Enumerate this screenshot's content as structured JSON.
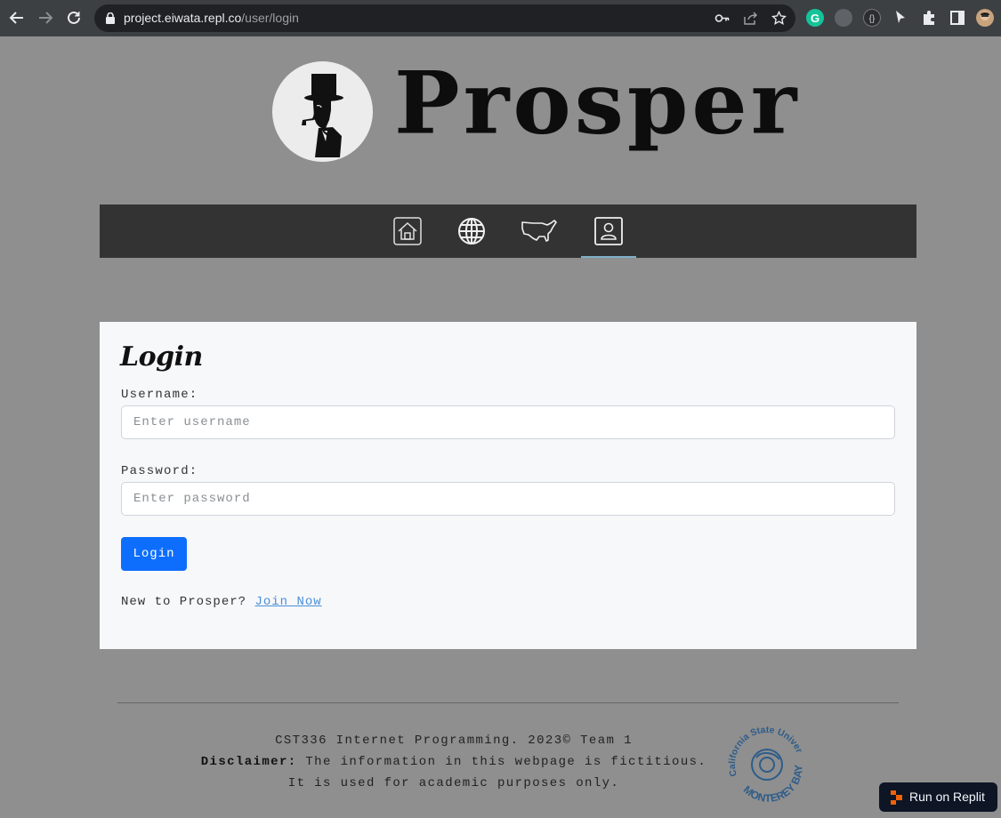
{
  "browser": {
    "url_host": "project.eiwata.repl.co",
    "url_path": "/user/login",
    "icons": [
      "back-arrow-icon",
      "forward-arrow-icon",
      "reload-icon",
      "lock-icon",
      "key-icon",
      "share-icon",
      "star-icon",
      "grammarly-icon",
      "extension-icon",
      "puzzle-icon",
      "sidebar-icon",
      "profile-avatar"
    ]
  },
  "header": {
    "brand": "Prosper",
    "logo_icon": "gentleman-top-hat-icon"
  },
  "nav": {
    "items": [
      {
        "name": "home",
        "icon": "home-icon"
      },
      {
        "name": "world",
        "icon": "globe-icon"
      },
      {
        "name": "usa",
        "icon": "usa-map-icon"
      },
      {
        "name": "user",
        "icon": "user-icon",
        "active": true
      }
    ],
    "active_color": "#7fb0c8"
  },
  "login": {
    "title": "Login",
    "username_label": "Username:",
    "username_placeholder": "Enter username",
    "password_label": "Password:",
    "password_placeholder": "Enter password",
    "submit_label": "Login",
    "new_text": "New to Prosper?",
    "join_link": "Join Now",
    "button_color": "#0d6efd"
  },
  "footer": {
    "line1": "CST336 Internet Programming. 2023© Team 1",
    "disclaimer_label": "Disclaimer:",
    "disclaimer_text": "The information in this webpage is fictitious.",
    "line3": "It is used for academic purposes only.",
    "seal_top": "California State University",
    "seal_bottom": "MONTEREY BAY"
  },
  "replit_badge": "Run on Replit"
}
